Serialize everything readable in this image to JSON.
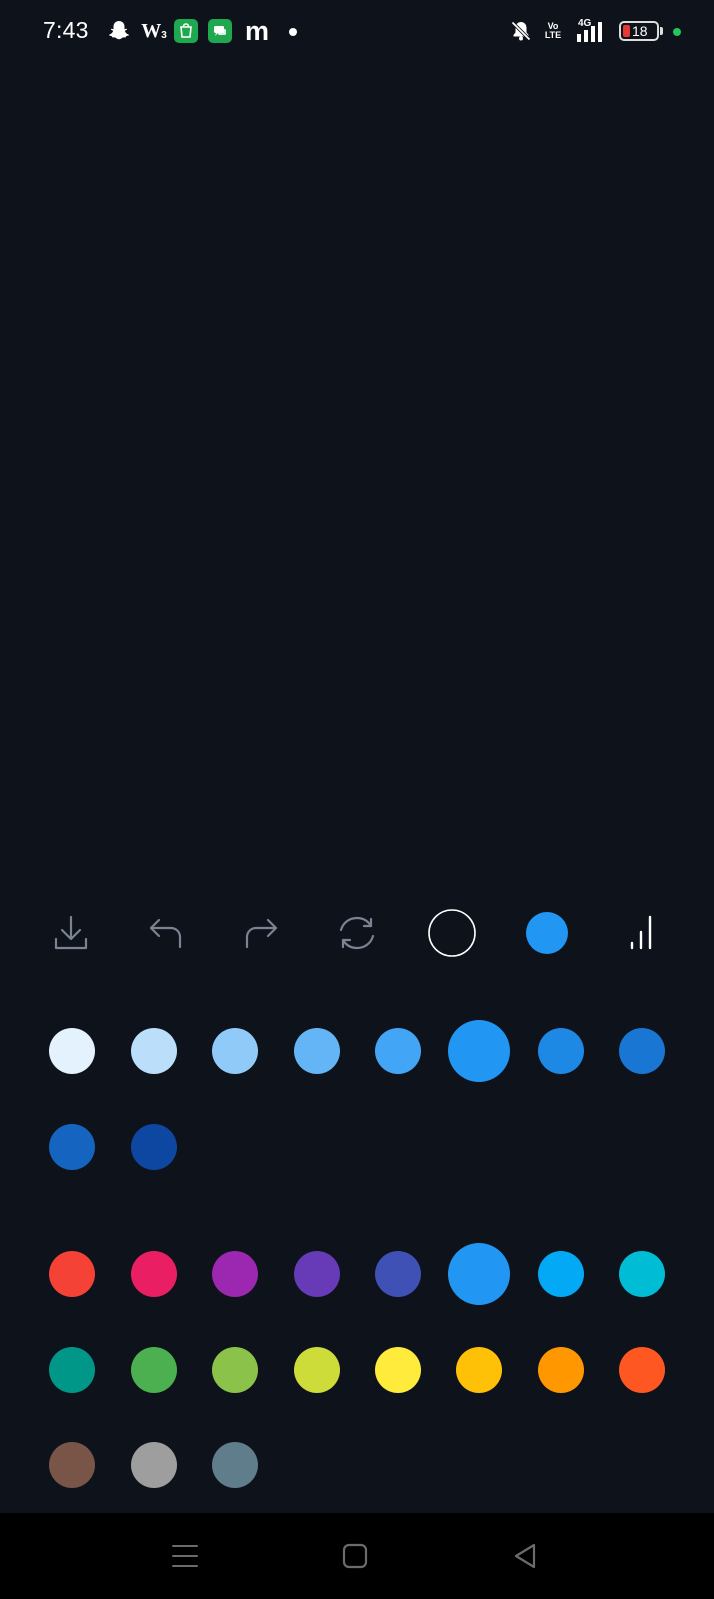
{
  "status_bar": {
    "time": "7:43",
    "left_icons": [
      "snapchat-icon",
      "w-app-icon",
      "shopping-app-icon",
      "messages-app-icon",
      "m-app-icon",
      "notification-dot-icon"
    ],
    "w_label": "W",
    "w_sub": "3",
    "m_label": "m",
    "volte_top": "Vo",
    "volte_bottom": "LTE",
    "network": "4G",
    "battery_level": "18",
    "battery_color": "#e53935",
    "indicator_color": "#22c55e"
  },
  "toolbar": {
    "tools": [
      "download-icon",
      "undo-icon",
      "redo-icon",
      "refresh-icon",
      "brush-outline-icon",
      "selected-color-icon",
      "stroke-size-icon"
    ],
    "selected_color": "#2196f3"
  },
  "palette": {
    "shades_selected": "#2196f3",
    "shades": [
      "#e3f2fd",
      "#bbdefb",
      "#90caf9",
      "#64b5f6",
      "#42a5f5",
      "#2196f3",
      "#1e88e5",
      "#1976d2",
      "#1565c0",
      "#0d47a1"
    ],
    "colors_selected": "#2196f3",
    "colors": [
      "#f44336",
      "#e91e63",
      "#9c27b0",
      "#673ab7",
      "#3f51b5",
      "#2196f3",
      "#03a9f4",
      "#00bcd4",
      "#009688",
      "#4caf50",
      "#8bc34a",
      "#cddc39",
      "#ffeb3b",
      "#ffc107",
      "#ff9800",
      "#ff5722",
      "#795548",
      "#9e9e9e",
      "#607d8b"
    ]
  },
  "nav_bar": {
    "buttons": [
      "recent-apps-icon",
      "home-icon",
      "back-icon"
    ]
  }
}
